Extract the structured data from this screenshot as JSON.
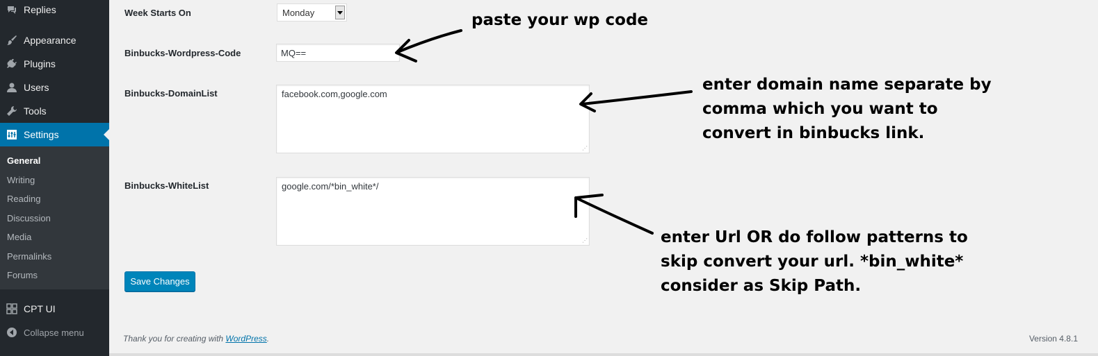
{
  "sidebar": {
    "items": [
      {
        "label": "Replies",
        "icon": "replies-icon"
      },
      {
        "label": "Appearance",
        "icon": "paintbrush-icon"
      },
      {
        "label": "Plugins",
        "icon": "plugins-icon"
      },
      {
        "label": "Users",
        "icon": "users-icon"
      },
      {
        "label": "Tools",
        "icon": "wrench-icon"
      },
      {
        "label": "Settings",
        "icon": "settings-icon"
      }
    ],
    "submenu": [
      "General",
      "Writing",
      "Reading",
      "Discussion",
      "Media",
      "Permalinks",
      "Forums"
    ],
    "cpt_ui": "CPT UI",
    "collapse": "Collapse menu"
  },
  "form": {
    "week_starts_label": "Week Starts On",
    "week_starts_value": "Monday",
    "code_label": "Binbucks-Wordpress-Code",
    "code_value": "MQ==",
    "domain_label": "Binbucks-DomainList",
    "domain_value": "facebook.com,google.com",
    "whitelist_label": "Binbucks-WhiteList",
    "whitelist_value": "google.com/*bin_white*/",
    "save_label": "Save Changes"
  },
  "annotations": {
    "code": "paste your wp code",
    "domain": [
      "enter domain name separate by",
      "comma which you want to",
      "convert in binbucks link."
    ],
    "whitelist": [
      "enter Url OR do follow patterns to",
      "skip convert your url. *bin_white*",
      "consider as Skip Path."
    ]
  },
  "footer": {
    "thanks": "Thank you for creating with ",
    "link": "WordPress",
    "period": ".",
    "version": "Version 4.8.1"
  },
  "colors": {
    "sidebar_bg": "#23282d",
    "submenu_bg": "#32373c",
    "accent": "#0073aa",
    "button": "#0085ba",
    "page_bg": "#f1f1f1"
  }
}
